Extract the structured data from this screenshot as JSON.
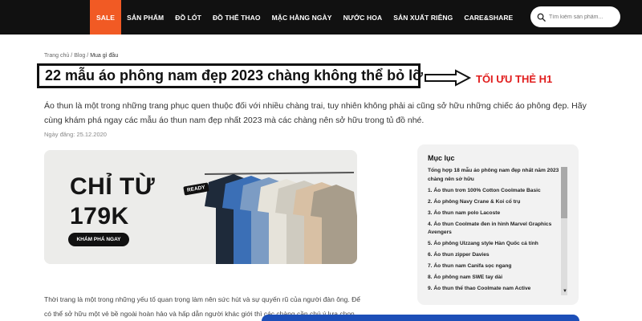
{
  "nav": {
    "items": [
      {
        "label": "SALE",
        "key": "sale"
      },
      {
        "label": "SẢN PHẨM",
        "key": "products"
      },
      {
        "label": "ĐỒ LÓT",
        "key": "underwear"
      },
      {
        "label": "ĐỒ THỂ THAO",
        "key": "sportswear"
      },
      {
        "label": "MẶC HẰNG NGÀY",
        "key": "everyday"
      },
      {
        "label": "NƯỚC HOA",
        "key": "perfume"
      },
      {
        "label": "SẢN XUẤT RIÊNG",
        "key": "custom"
      },
      {
        "label": "CARE&SHARE",
        "key": "care-share"
      }
    ],
    "sale_color": "#f15a24",
    "bar_color": "#111111"
  },
  "search": {
    "placeholder": "Tìm kiếm sản phẩm...",
    "value": "",
    "icon": "search-icon"
  },
  "breadcrumb": {
    "home": "Trang chủ",
    "blog": "Blog",
    "current": "Mua gì đầu",
    "separator": "/"
  },
  "article": {
    "title": "22 mẫu áo phông nam đẹp 2023 chàng không thể bỏ lỡ",
    "intro": "Áo thun là một trong những trang phục quen thuộc đối với nhiều chàng trai, tuy nhiên không phải ai cũng sở hữu những chiếc áo phông đẹp. Hãy cùng khám phá ngay các mẫu áo thun nam đẹp nhất 2023 mà các chàng nên sở hữu trong tủ đồ nhé.",
    "date": "Ngày đăng: 25.12.2020",
    "body": "Thời trang là một trong những yếu tố quan trọng làm nên sức hút và sự quyến rũ của người đàn ông. Để có thể sở hữu một vẻ bề ngoài hoàn hảo và hấp dẫn người khác giới thì các chàng cần chú ý lựa chọn những mẫu trang phục đẹp nổi bật cá tính."
  },
  "annotation": {
    "label": "TỐI ƯU THẺ H1",
    "color": "#e11d1d"
  },
  "banner": {
    "headline": "CHỈ TỪ",
    "price": "179K",
    "cta": "KHÁM PHÁ NGAY",
    "badge": "READY"
  },
  "toc": {
    "title": "Mục lục",
    "items": [
      "Tổng hợp 18 mẫu áo phông nam đẹp nhất năm 2023 chàng nên sở hữu",
      "1. Áo thun trơn 100% Cotton Coolmate Basic",
      "2. Áo phông Navy Crane & Koi cổ trụ",
      "3. Áo thun nam polo Lacoste",
      "4. Áo thun Coolmate đen in hình Marvel Graphics Avengers",
      "5. Áo phông Ulzzang style Hàn Quốc cá tính",
      "6. Áo thun zipper Davies",
      "7. Áo thun nam Canifa sọc ngang",
      "8. Áo phông nam SWE tay dài",
      "9. Áo thun thể thao Coolmate nam Active"
    ]
  }
}
